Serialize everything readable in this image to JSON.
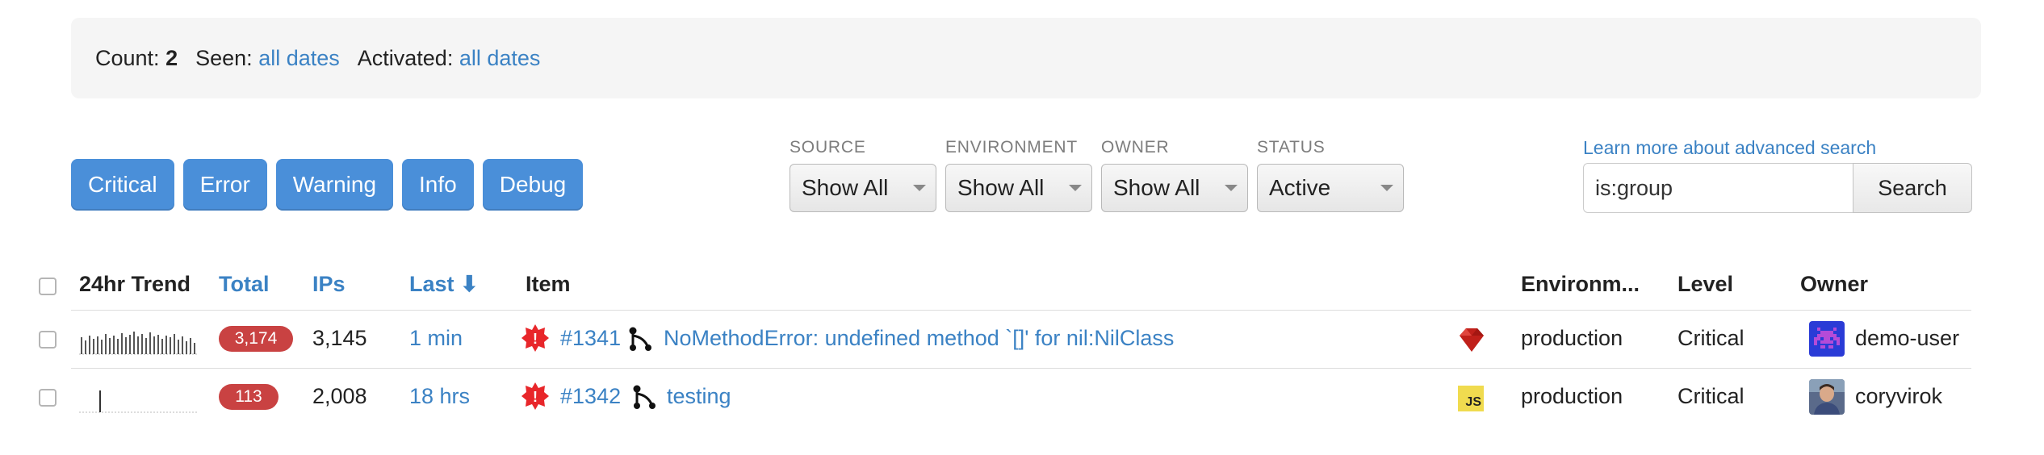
{
  "summary": {
    "count_label": "Count:",
    "count_value": "2",
    "seen_label": "Seen:",
    "seen_value": "all dates",
    "activated_label": "Activated:",
    "activated_value": "all dates"
  },
  "levels": [
    "Critical",
    "Error",
    "Warning",
    "Info",
    "Debug"
  ],
  "filters": {
    "source": {
      "label": "SOURCE",
      "value": "Show All"
    },
    "environment": {
      "label": "ENVIRONMENT",
      "value": "Show All"
    },
    "owner": {
      "label": "OWNER",
      "value": "Show All"
    },
    "status": {
      "label": "STATUS",
      "value": "Active"
    }
  },
  "search": {
    "advanced_link": "Learn more about advanced search",
    "query": "is:group",
    "button": "Search"
  },
  "table": {
    "headers": {
      "trend": "24hr Trend",
      "total": "Total",
      "ips": "IPs",
      "last": "Last ⬇",
      "item": "Item",
      "environment": "Environm...",
      "level": "Level",
      "owner": "Owner"
    },
    "rows": [
      {
        "total": "3,174",
        "ips": "3,145",
        "last": "1 min",
        "id": "#1341",
        "title": "NoMethodError: undefined method `[]' for nil:NilClass",
        "platform_icon": "ruby-icon",
        "environment": "production",
        "level": "Critical",
        "owner": "demo-user",
        "owner_avatar": "space-invader-avatar"
      },
      {
        "total": "113",
        "ips": "2,008",
        "last": "18 hrs",
        "id": "#1342",
        "title": "testing",
        "platform_icon": "javascript-icon",
        "platform_label": "JS",
        "environment": "production",
        "level": "Critical",
        "owner": "coryvirok",
        "owner_avatar": "photo-avatar"
      }
    ]
  },
  "colors": {
    "accent": "#4a8fd9",
    "link": "#3b82c4",
    "badge": "#c94242",
    "critical_icon": "#e8262a"
  }
}
